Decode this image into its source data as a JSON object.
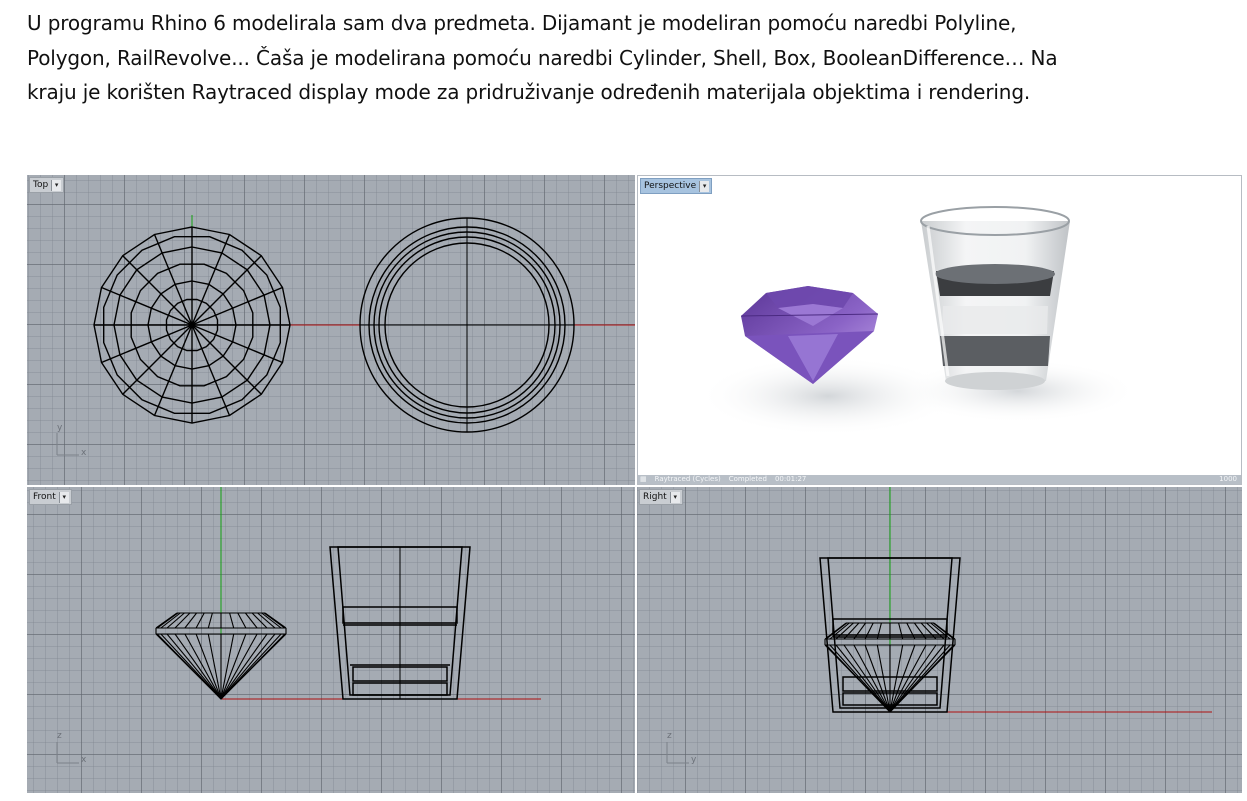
{
  "intro": {
    "lines": [
      "U programu Rhino 6 modelirala sam dva predmeta. Dijamant je modeliran pomoću naredbi Polyline,",
      "Polygon, RailRevolve... Čaša je modelirana pomoću naredbi Cylinder, Shell, Box, BooleanDifference… Na",
      "kraju je korišten Raytraced display mode za pridruživanje određenih materijala objektima i rendering."
    ]
  },
  "viewports": {
    "top": {
      "label": "Top",
      "axis_a": "y",
      "axis_b": "x"
    },
    "persp": {
      "label": "Perspective"
    },
    "front": {
      "label": "Front",
      "axis_a": "z",
      "axis_b": "x"
    },
    "right": {
      "label": "Right",
      "axis_a": "z",
      "axis_b": "y"
    }
  },
  "render_status": {
    "mode": "Raytraced (Cycles)",
    "state": "Completed",
    "time": "00:01:27",
    "samples": "1000"
  },
  "colors": {
    "viewport_bg": "#a5abb3",
    "wire": "#000000",
    "x_axis": "#b01010",
    "y_axis": "#12a012",
    "gem": "#7a52b8",
    "active_tab": "#a7c3df"
  }
}
